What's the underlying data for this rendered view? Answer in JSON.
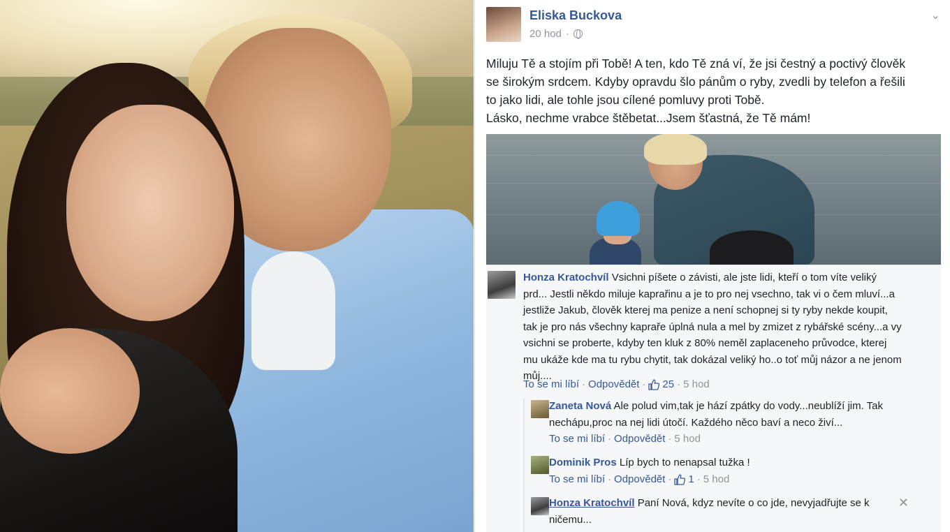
{
  "post": {
    "author": "Eliska Buckova",
    "time": "20 hod",
    "separator": "·",
    "text_lines": [
      "Miluju Tě a stojím při Tobě! A ten, kdo Tě zná ví, že jsi čestný a poctivý člověk",
      "se širokým srdcem. Kdyby opravdu šlo pánům o ryby, zvedli by telefon a řešili",
      "to jako lidi, ale tohle jsou cílené pomluvy proti Tobě.",
      "Lásko, nechme vrabce štěbetat...Jsem šťastná, že Tě mám!"
    ]
  },
  "comments": [
    {
      "name": "Honza Kratochvíl",
      "first_line": "Vsichni píšete o závisti, ale jste lidi, kteří o tom víte veliký",
      "lines": [
        "prd... Jestli někdo miluje kaprařinu a je to pro nej vsechno, tak vi o čem mluví...a",
        "jestliže Jakub, člověk kterej ma penize a není schopnej si ty ryby nekde koupit,",
        "tak je pro nás všechny kapraře úplná nula a mel by zmizet z rybářské scény...a vy",
        "vsichni se proberte, kdyby ten kluk z 80% neměl zaplaceneho průvodce, kterej",
        "mu ukáže kde ma tu rybu chytit, tak dokázal veliký ho..o toť můj názor a ne jenom",
        "můj...."
      ],
      "like_label": "To se mi líbí",
      "reply_label": "Odpovědět",
      "likes": "25",
      "time": "5 hod"
    },
    {
      "name": "Zaneta Nová",
      "first_line": "Ale polud vim,tak je hází zpátky do vody...neublíží jim. Tak",
      "lines": [
        "nechápu,proc na nej lidi útočí. Každého něco baví a neco živí..."
      ],
      "like_label": "To se mi líbí",
      "reply_label": "Odpovědět",
      "time": "5 hod"
    },
    {
      "name": "Dominik Pros",
      "first_line": "Líp bych to nenapsal tužka !",
      "like_label": "To se mi líbí",
      "reply_label": "Odpovědět",
      "likes": "1",
      "time": "5 hod"
    },
    {
      "name": "Honza Kratochvíl",
      "first_line": "Paní Nová, kdyz nevíte o co jde, nevyjadřujte se k",
      "lines": [
        "ničemu..."
      ]
    }
  ],
  "ui": {
    "dot": "·",
    "close_glyph": "✕",
    "chevron_glyph": "⌄"
  },
  "colors": {
    "link_blue": "#365899",
    "meta_gray": "#90949c",
    "comment_bg": "#f6f7f9"
  }
}
